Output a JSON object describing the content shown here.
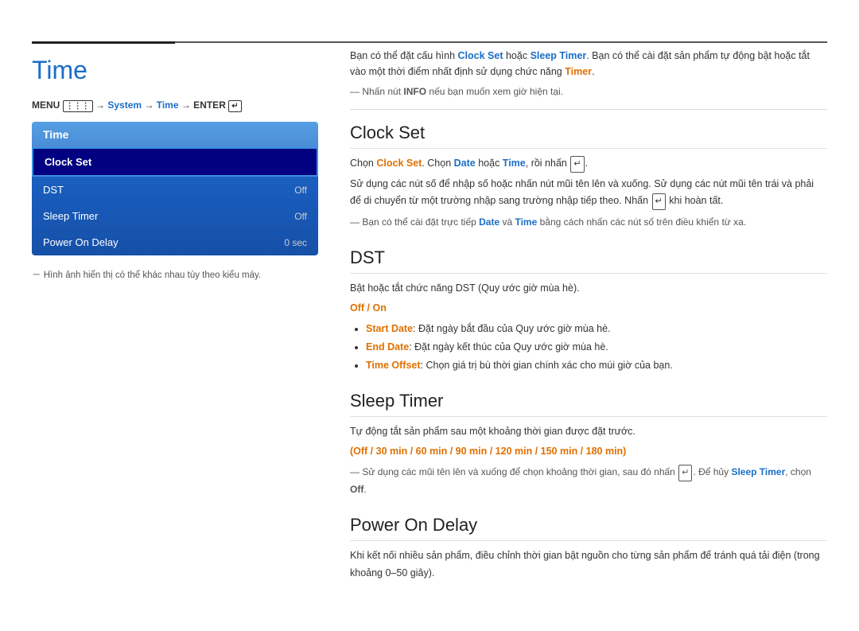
{
  "page": {
    "title": "Time",
    "top_border_note": "",
    "menu_path": "MENU  → System → Time → ENTER"
  },
  "menu": {
    "header": "Time",
    "items": [
      {
        "label": "Clock Set",
        "value": "",
        "active": true
      },
      {
        "label": "DST",
        "value": "Off",
        "active": false
      },
      {
        "label": "Sleep Timer",
        "value": "Off",
        "active": false
      },
      {
        "label": "Power On Delay",
        "value": "0 sec",
        "active": false
      }
    ]
  },
  "left_note": "Hình ảnh hiển thị có thể khác nhau tùy theo kiểu máy.",
  "intro": {
    "text": "Bạn có thể đặt cấu hình Clock Set hoặc Sleep Timer. Bạn có thể cài đặt sản phẩm tự động bật hoặc tắt vào một thời điểm nhất định sử dụng chức năng Timer.",
    "note": "Nhấn nút INFO nếu bạn muốn xem giờ hiện tại."
  },
  "sections": [
    {
      "id": "clock-set",
      "title": "Clock Set",
      "paragraphs": [
        "Chọn Clock Set. Chọn Date hoặc Time, rồi nhấn ↵.",
        "Sử dụng các nút số để nhập số hoặc nhấn nút mũi tên lên và xuống. Sử dụng các nút mũi tên trái và phải để di chuyển từ một trường nhập sang trường nhập tiếp theo. Nhấn ↵ khi hoàn tất."
      ],
      "note": "Bạn có thể cài đặt trực tiếp Date và Time bằng cách nhấn các nút số trên điều khiển từ xa.",
      "subitems": []
    },
    {
      "id": "dst",
      "title": "DST",
      "paragraphs": [
        "Bật hoặc tắt chức năng DST (Quy ước giờ mùa hè)."
      ],
      "off_on_label": "Off / On",
      "note": "",
      "subitems": [
        "Start Date: Đặt ngày bắt đầu của Quy ước giờ mùa hè.",
        "End Date: Đặt ngày kết thúc của Quy ước giờ mùa hè.",
        "Time Offset: Chọn giá trị bù thời gian chính xác cho múi giờ của bạn."
      ]
    },
    {
      "id": "sleep-timer",
      "title": "Sleep Timer",
      "paragraphs": [
        "Tự động tắt sản phẩm sau một khoảng thời gian được đặt trước."
      ],
      "options_label": "(Off / 30 min / 60 min / 90 min / 120 min / 150 min / 180 min)",
      "note": "Sử dụng các mũi tên lên và xuống để chọn khoảng thời gian, sau đó nhấn ↵. Để hủy Sleep Timer, chọn Off.",
      "subitems": []
    },
    {
      "id": "power-on-delay",
      "title": "Power On Delay",
      "paragraphs": [
        "Khi kết nối nhiều sản phẩm, điều chỉnh thời gian bật nguồn cho từng sản phẩm để tránh quá tải điện (trong khoảng 0–50 giây)."
      ],
      "note": "",
      "subitems": []
    }
  ]
}
